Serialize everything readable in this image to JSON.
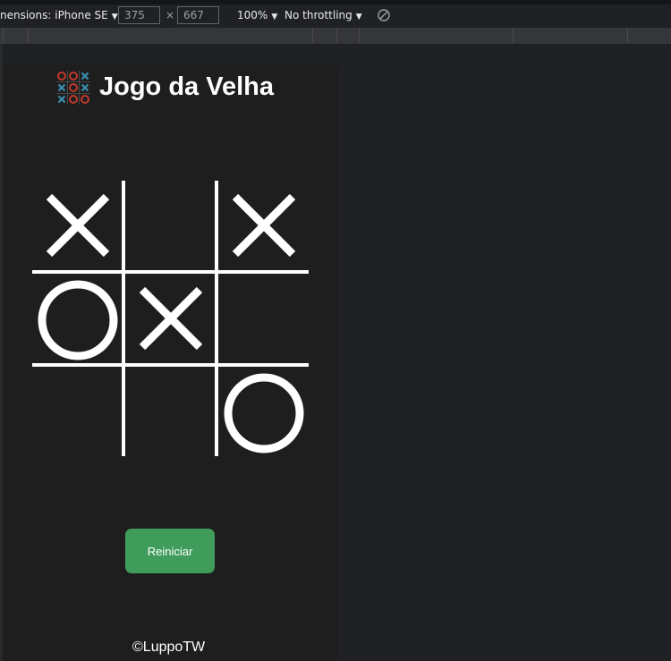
{
  "devtools": {
    "dimensions_label": "nensions: iPhone SE",
    "width_value": "375",
    "height_value": "667",
    "times_sign": "×",
    "zoom": "100%",
    "throttling": "No throttling"
  },
  "game": {
    "title": "Jogo da Velha",
    "board": [
      "X",
      "",
      "X",
      "O",
      "X",
      "",
      "",
      "",
      "O"
    ],
    "restart_label": "Reiniciar",
    "footer": "©LuppoTW"
  },
  "colors": {
    "button": "#3f9c5a",
    "logo_x": "#3a8fb0",
    "logo_o": "#c0392b"
  }
}
